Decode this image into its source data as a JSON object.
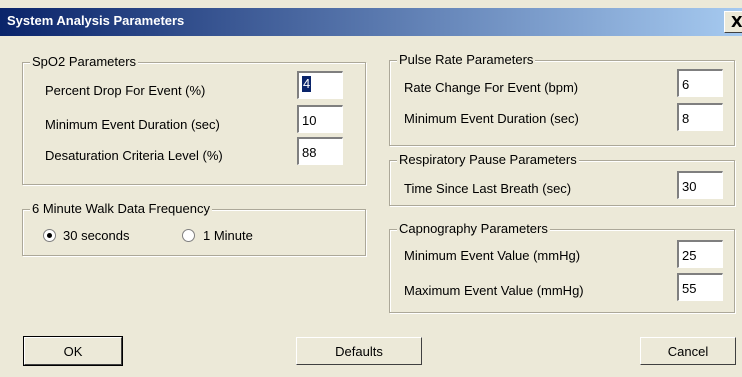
{
  "window": {
    "title": "System Analysis Parameters",
    "close_glyph": "X"
  },
  "spo2": {
    "title": "SpO2 Parameters",
    "percent_drop_label": "Percent Drop For Event (%)",
    "percent_drop_value": "4",
    "min_duration_label": "Minimum Event Duration (sec)",
    "min_duration_value": "10",
    "desat_label": "Desaturation Criteria Level (%)",
    "desat_value": "88"
  },
  "walk": {
    "title": "6 Minute Walk Data Frequency",
    "option_30s": "30 seconds",
    "option_1m": "1 Minute",
    "selected": "30 seconds"
  },
  "pulse": {
    "title": "Pulse Rate Parameters",
    "rate_change_label": "Rate Change For Event (bpm)",
    "rate_change_value": "6",
    "min_duration_label": "Minimum Event Duration (sec)",
    "min_duration_value": "8"
  },
  "resp": {
    "title": "Respiratory Pause Parameters",
    "time_since_label": "Time Since Last Breath (sec)",
    "time_since_value": "30"
  },
  "capno": {
    "title": "Capnography Parameters",
    "min_value_label": "Minimum Event Value (mmHg)",
    "min_value": "25",
    "max_value_label": "Maximum Event Value (mmHg)",
    "max_value": "55"
  },
  "buttons": {
    "ok": "OK",
    "defaults": "Defaults",
    "cancel": "Cancel"
  },
  "colors": {
    "face": "#ece9d8",
    "title_start": "#0a246a",
    "title_end": "#a6caf0",
    "selection": "#0a246a"
  }
}
